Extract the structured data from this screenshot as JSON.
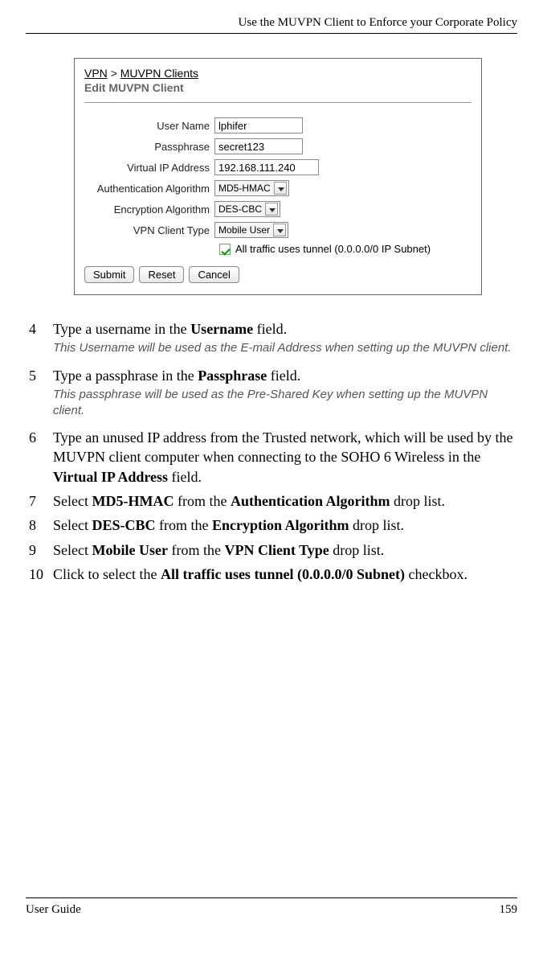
{
  "header": {
    "title": "Use the MUVPN Client to Enforce your Corporate Policy"
  },
  "screenshot": {
    "breadcrumb_root": "VPN",
    "breadcrumb_sep": ">",
    "breadcrumb_leaf": "MUVPN Clients",
    "title": "Edit MUVPN Client",
    "fields": {
      "username_label": "User Name",
      "username_value": "lphifer",
      "passphrase_label": "Passphrase",
      "passphrase_value": "secret123",
      "vip_label": "Virtual IP Address",
      "vip_value": "192.168.111.240",
      "auth_label": "Authentication Algorithm",
      "auth_value": "MD5-HMAC",
      "enc_label": "Encryption Algorithm",
      "enc_value": "DES-CBC",
      "ctype_label": "VPN Client Type",
      "ctype_value": "Mobile User",
      "cb_label": "All traffic uses tunnel (0.0.0.0/0 IP Subnet)"
    },
    "buttons": {
      "submit": "Submit",
      "reset": "Reset",
      "cancel": "Cancel"
    }
  },
  "steps": [
    {
      "num": "4",
      "parts": [
        "Type a username in the ",
        "Username",
        " field."
      ],
      "note": "This Username will be used as the E-mail Address when setting up the MUVPN client."
    },
    {
      "num": "5",
      "parts": [
        "Type a passphrase in the ",
        "Passphrase",
        " field."
      ],
      "note": "This passphrase will be used as the Pre-Shared Key when setting up the MUVPN client."
    },
    {
      "num": "6",
      "parts": [
        "Type an unused IP address from the Trusted network, which will be used by the MUVPN client computer when connecting to the SOHO 6 Wireless in the ",
        "Virtual IP Address",
        " field."
      ]
    },
    {
      "num": "7",
      "parts": [
        "Select ",
        "MD5-HMAC",
        " from the ",
        "Authentication Algorithm",
        " drop list."
      ]
    },
    {
      "num": "8",
      "parts": [
        "Select ",
        "DES-CBC",
        " from the ",
        "Encryption Algorithm",
        " drop list."
      ]
    },
    {
      "num": "9",
      "parts": [
        "Select ",
        "Mobile User",
        " from the ",
        "VPN Client Type",
        " drop list."
      ]
    },
    {
      "num": "10",
      "parts": [
        "Click to select the ",
        "All traffic uses tunnel (0.0.0.0/0 Subnet)",
        " checkbox."
      ]
    }
  ],
  "footer": {
    "left": "User Guide",
    "right": "159"
  }
}
